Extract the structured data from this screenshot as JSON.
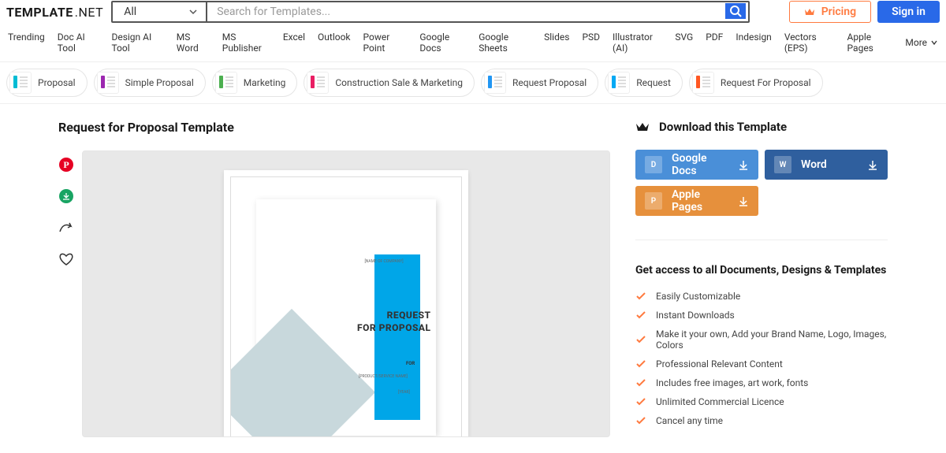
{
  "header": {
    "logo_main": "TEMPLATE",
    "logo_ext": ".NET",
    "category_selected": "All",
    "search_placeholder": "Search for Templates...",
    "pricing_label": "Pricing",
    "signin_label": "Sign in"
  },
  "nav": {
    "items": [
      "Trending",
      "Doc AI Tool",
      "Design AI Tool",
      "MS Word",
      "MS Publisher",
      "Excel",
      "Outlook",
      "Power Point",
      "Google Docs",
      "Google Sheets",
      "Slides",
      "PSD",
      "Illustrator (AI)",
      "SVG",
      "PDF",
      "Indesign",
      "Vectors (EPS)",
      "Apple Pages"
    ],
    "more_label": "More"
  },
  "pills": [
    {
      "label": "Proposal"
    },
    {
      "label": "Simple Proposal"
    },
    {
      "label": "Marketing"
    },
    {
      "label": "Construction Sale & Marketing"
    },
    {
      "label": "Request Proposal"
    },
    {
      "label": "Request"
    },
    {
      "label": "Request For Proposal"
    }
  ],
  "page": {
    "title": "Request for Proposal Template"
  },
  "doc": {
    "company": "[NAME OF COMPANY]",
    "line1": "REQUEST",
    "line2": "FOR PROPOSAL",
    "for": "FOR",
    "product": "[PRODUCT/SERVICE NAME]",
    "year": "[YEAR]"
  },
  "download": {
    "section_title": "Download this Template",
    "buttons": [
      {
        "label": "Google Docs",
        "class": "dl-btn-blue",
        "ico": "D"
      },
      {
        "label": "Word",
        "class": "dl-btn-darkblue",
        "ico": "W"
      },
      {
        "label": "Apple Pages",
        "class": "dl-btn-orange",
        "ico": "P"
      }
    ]
  },
  "access": {
    "title": "Get access to all Documents, Designs & Templates",
    "features": [
      "Easily Customizable",
      "Instant Downloads",
      "Make it your own, Add your Brand Name, Logo, Images, Colors",
      "Professional Relevant Content",
      "Includes free images, art work, fonts",
      "Unlimited Commercial Licence",
      "Cancel any time"
    ]
  }
}
